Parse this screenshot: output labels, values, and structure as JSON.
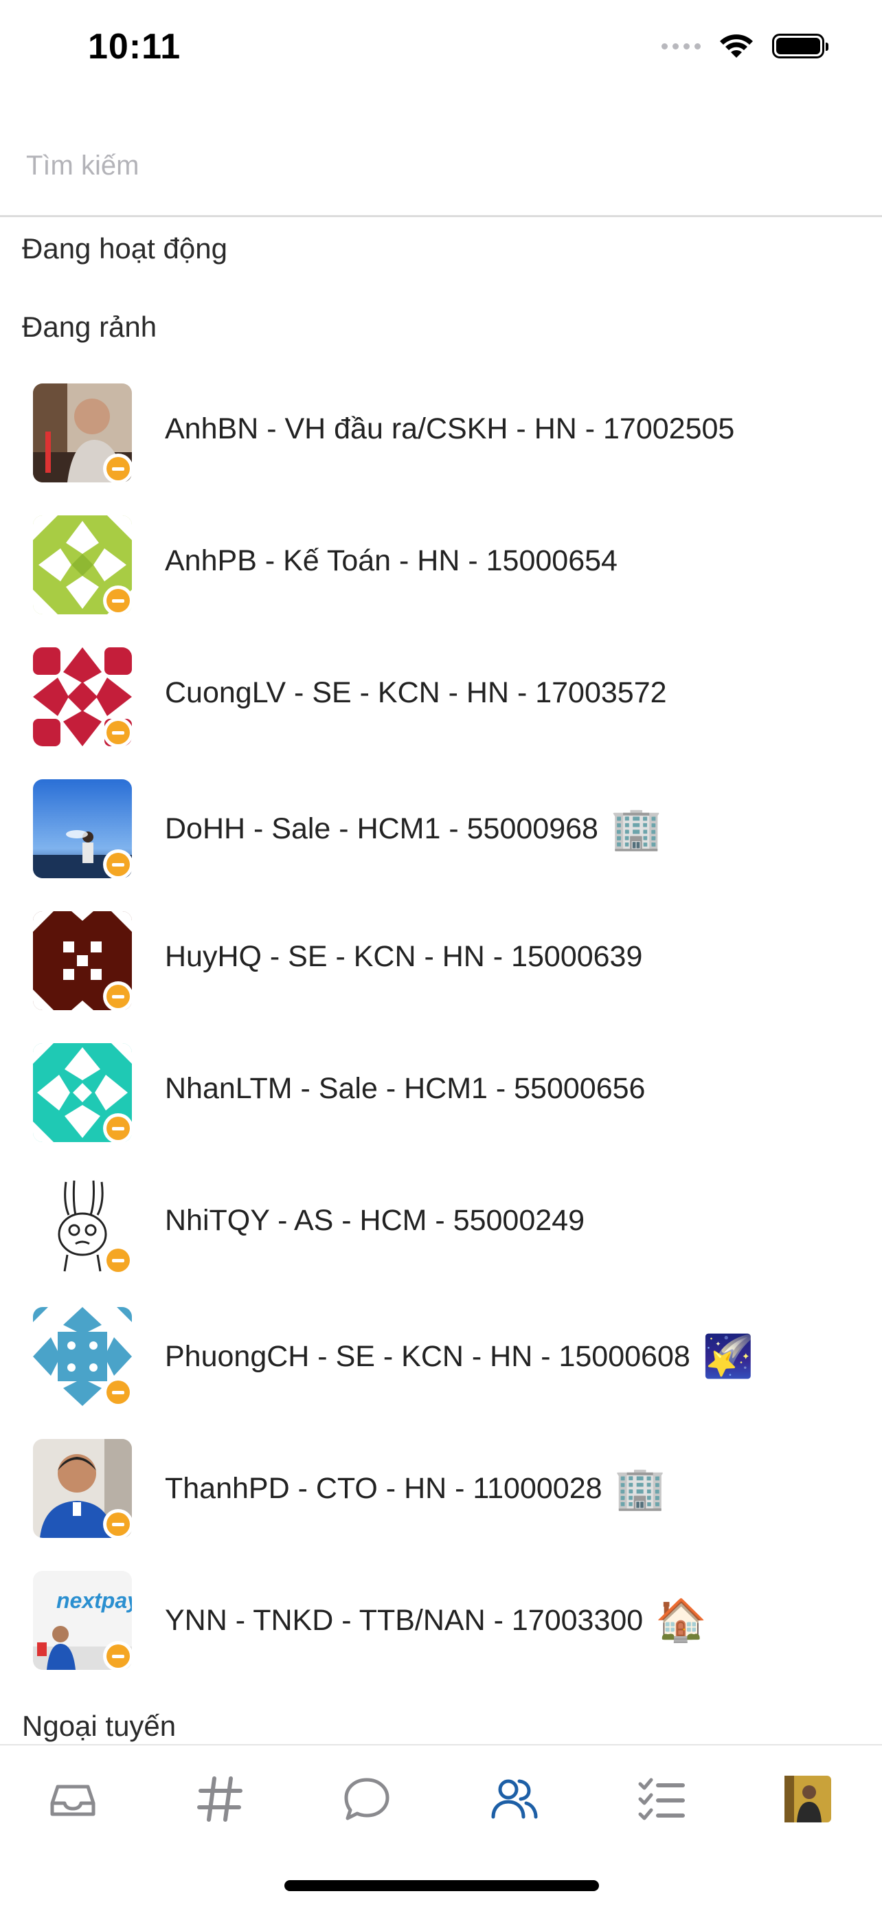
{
  "status_bar": {
    "time": "10:11"
  },
  "search": {
    "placeholder": "Tìm kiếm",
    "value": ""
  },
  "sections": {
    "active": "Đang hoạt động",
    "free": "Đang rảnh",
    "offline": "Ngoại tuyến"
  },
  "members": [
    {
      "name": "AnhBN - VH đầu ra/CSKH - HN - 17002505",
      "emoji": "",
      "avatar": "photo-man-cafe"
    },
    {
      "name": "AnhPB - Kế Toán - HN - 15000654",
      "emoji": "",
      "avatar": "identicon-green"
    },
    {
      "name": "CuongLV - SE - KCN - HN - 17003572",
      "emoji": "",
      "avatar": "identicon-red"
    },
    {
      "name": "DoHH - Sale - HCM1 - 55000968",
      "emoji": "🏢",
      "avatar": "photo-sea"
    },
    {
      "name": "HuyHQ - SE - KCN - HN - 15000639",
      "emoji": "",
      "avatar": "identicon-brown"
    },
    {
      "name": "NhanLTM - Sale - HCM1 - 55000656",
      "emoji": "",
      "avatar": "identicon-teal"
    },
    {
      "name": "NhiTQY - AS - HCM - 55000249",
      "emoji": "",
      "avatar": "sketch-rabbit"
    },
    {
      "name": "PhuongCH - SE - KCN - HN - 15000608",
      "emoji": "🌠",
      "avatar": "identicon-blue"
    },
    {
      "name": "ThanhPD - CTO - HN - 11000028",
      "emoji": "🏢",
      "avatar": "photo-man-office"
    },
    {
      "name": "YNN - TNKD - TTB/NAN - 17003300",
      "emoji": "🏠",
      "avatar": "photo-nextpay"
    }
  ],
  "avatar_text": {
    "nextpay_logo": "nextpay"
  },
  "member_status": "away",
  "colors": {
    "status_away": "#f5a623",
    "tab_active": "#1d5fa6",
    "tab_inactive": "#8a8a8e"
  },
  "tabs": [
    {
      "name": "inbox",
      "icon": "inbox-icon",
      "active": false
    },
    {
      "name": "channels",
      "icon": "hash-icon",
      "active": false
    },
    {
      "name": "messages",
      "icon": "chat-bubble-icon",
      "active": false
    },
    {
      "name": "members",
      "icon": "people-icon",
      "active": true
    },
    {
      "name": "tasks",
      "icon": "checklist-icon",
      "active": false
    },
    {
      "name": "profile",
      "icon": "user-avatar",
      "active": false
    }
  ]
}
